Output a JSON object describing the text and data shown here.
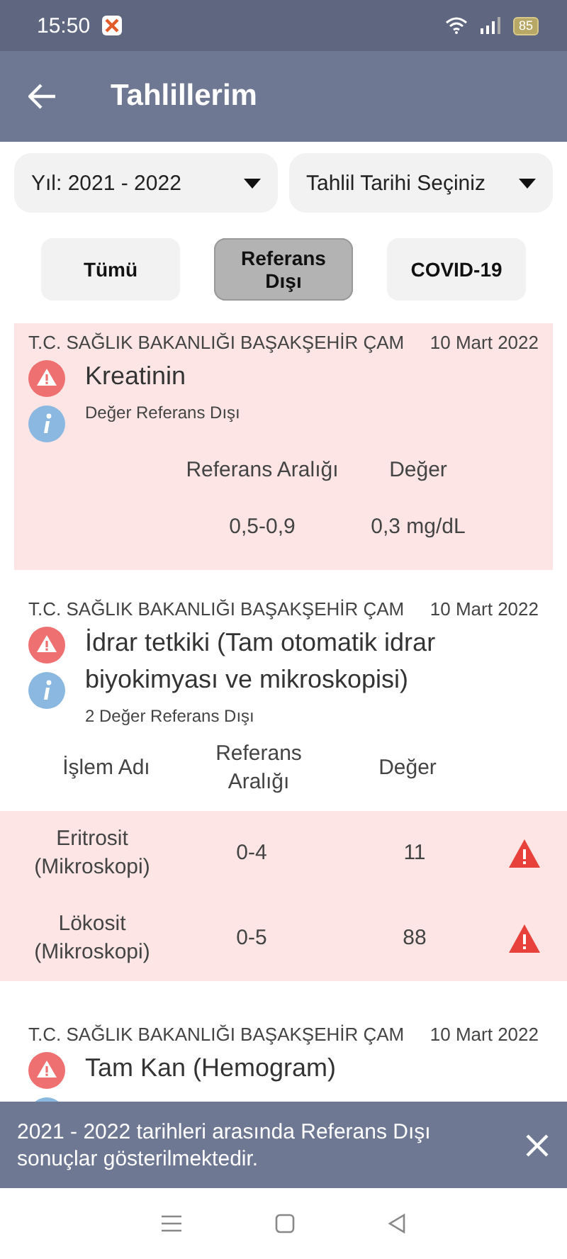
{
  "status_bar": {
    "time": "15:50",
    "battery": "85"
  },
  "app_bar": {
    "title": "Tahlillerim"
  },
  "filters": [
    {
      "label": "Yıl: 2021 - 2022"
    },
    {
      "label": "Tahlil Tarihi Seçiniz"
    }
  ],
  "tabs": [
    {
      "label": "Tümü",
      "selected": false
    },
    {
      "label": "Referans Dışı",
      "selected": true
    },
    {
      "label": "COVID-19",
      "selected": false
    }
  ],
  "results": [
    {
      "kind": "single",
      "highlighted": true,
      "hospital": "T.C. SAĞLIK BAKANLIĞI BAŞAKŞEHİR ÇAM",
      "date": "10 Mart 2022",
      "title": "Kreatinin",
      "subtitle": "Değer Referans Dışı",
      "columns": [
        "Referans Aralığı",
        "Değer"
      ],
      "values": [
        "0,5-0,9",
        "0,3 mg/dL"
      ]
    },
    {
      "kind": "multi",
      "highlighted": false,
      "hospital": "T.C. SAĞLIK BAKANLIĞI BAŞAKŞEHİR ÇAM",
      "date": "10 Mart 2022",
      "title": "İdrar tetkiki (Tam otomatik idrar biyokimyası ve mikroskopisi)",
      "subtitle": "2 Değer Referans Dışı",
      "columns": [
        "İşlem Adı",
        "Referans Aralığı",
        "Değer"
      ],
      "rows": [
        {
          "name": "Eritrosit (Mikroskopi)",
          "range": "0-4",
          "value": "11",
          "out_of_range": true
        },
        {
          "name": "Lökosit (Mikroskopi)",
          "range": "0-5",
          "value": "88",
          "out_of_range": true
        }
      ]
    },
    {
      "kind": "single",
      "highlighted": false,
      "hospital": "T.C. SAĞLIK BAKANLIĞI BAŞAKŞEHİR ÇAM",
      "date": "10 Mart 2022",
      "title": "Tam Kan (Hemogram)"
    }
  ],
  "snackbar": {
    "message": "2021 - 2022 tarihleri arasında Referans Dışı sonuçlar gösterilmektedir."
  }
}
